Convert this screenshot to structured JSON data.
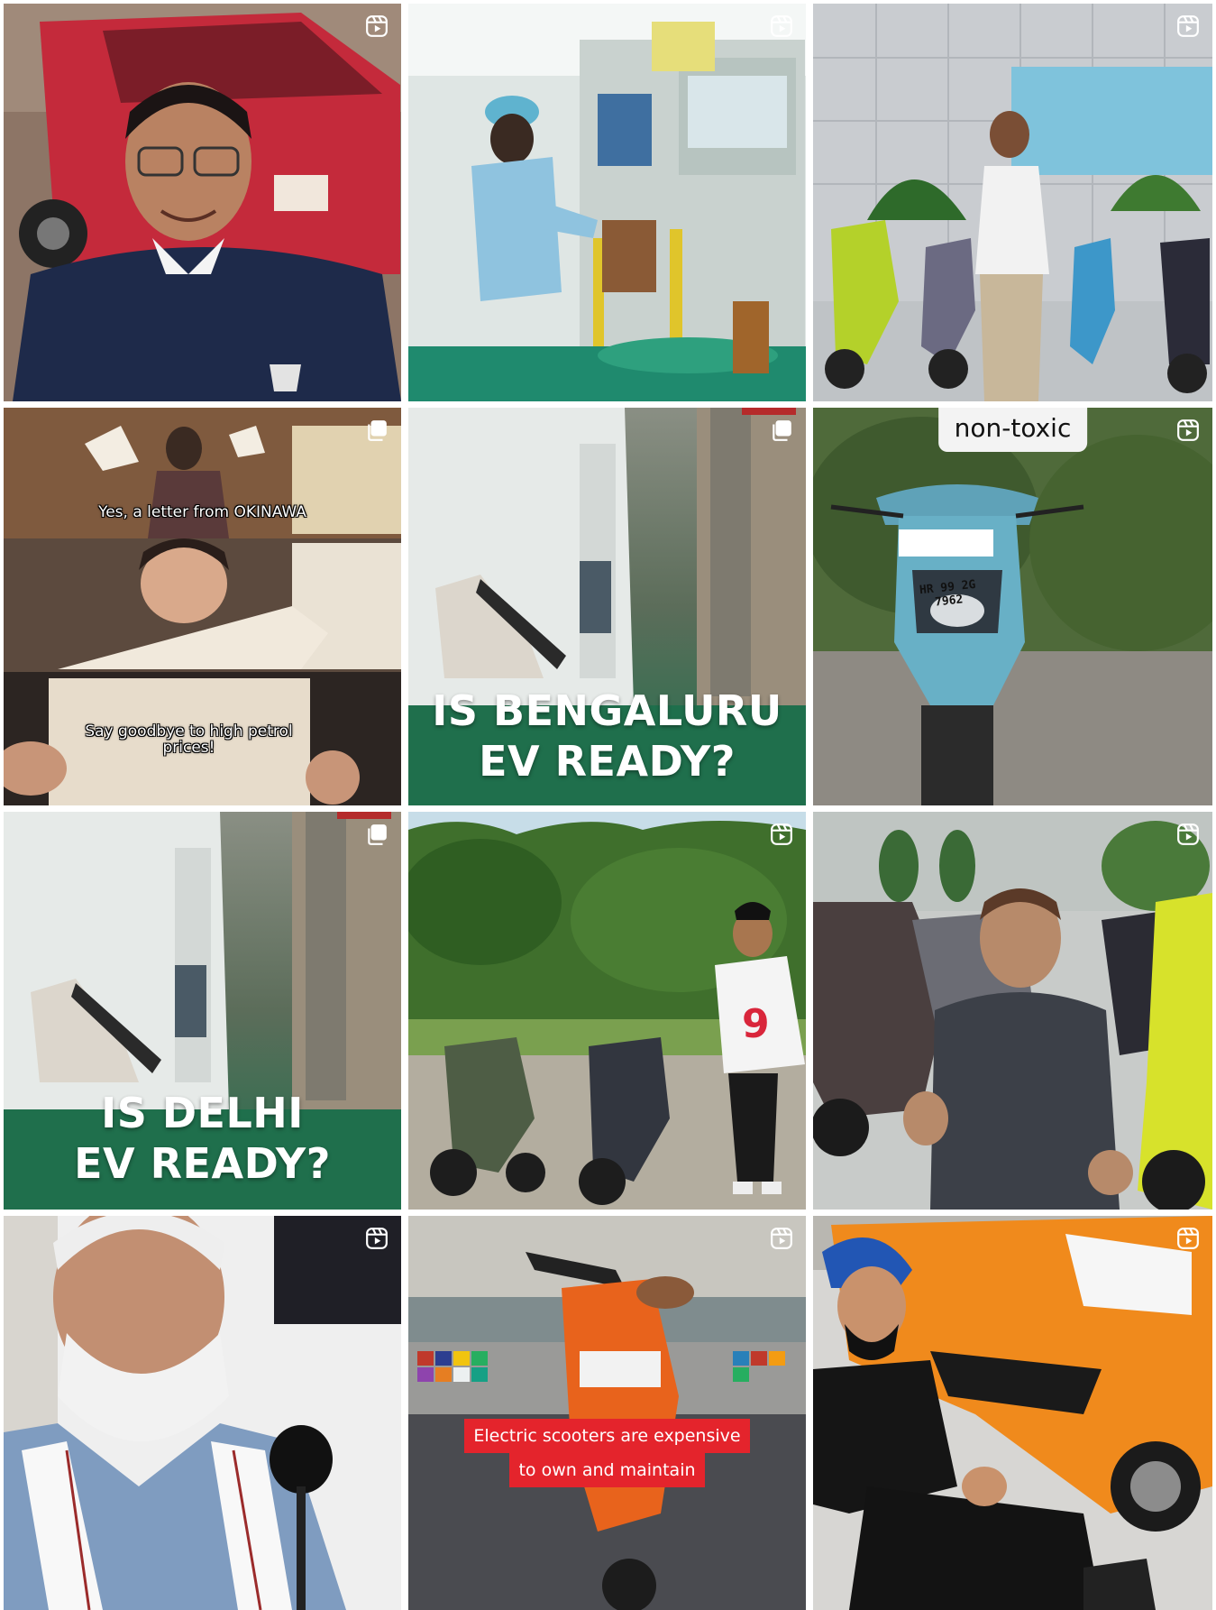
{
  "grid": {
    "tiles": [
      {
        "kind": "reel"
      },
      {
        "kind": "reel"
      },
      {
        "kind": "reel"
      },
      {
        "kind": "carousel",
        "captions": [
          "Yes, a letter from OKINAWA",
          "Say goodbye to high petrol prices!"
        ]
      },
      {
        "kind": "carousel",
        "title_line1": "IS BENGALURU",
        "title_line2": "EV READY?"
      },
      {
        "kind": "reel",
        "pill_label": "non-toxic",
        "plate": "HR 99 2G 7962"
      },
      {
        "kind": "carousel",
        "title_line1": "IS DELHI",
        "title_line2": "EV READY?"
      },
      {
        "kind": "reel",
        "jersey_number": "9"
      },
      {
        "kind": "reel"
      },
      {
        "kind": "reel"
      },
      {
        "kind": "reel",
        "caption_line1": "Electric scooters are expensive",
        "caption_line2": "to own and maintain"
      },
      {
        "kind": "reel"
      }
    ]
  },
  "icons": {
    "reel": "reels-icon",
    "carousel": "carousel-icon"
  },
  "colors": {
    "accent_green": "#1f6f4c",
    "caption_red": "#e4242c"
  }
}
